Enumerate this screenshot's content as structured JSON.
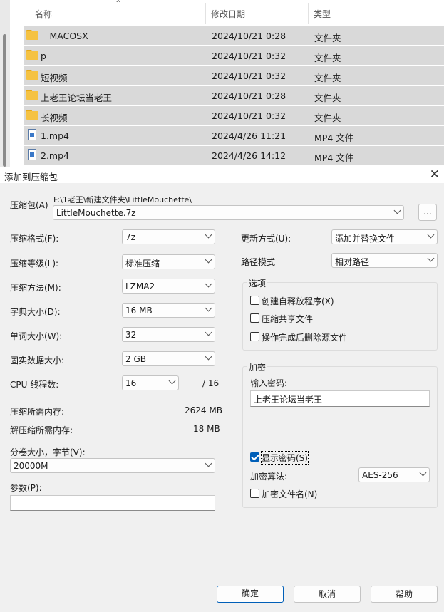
{
  "explorer": {
    "headers": {
      "name": "名称",
      "modified": "修改日期",
      "type": "类型"
    },
    "rows": [
      {
        "name": "__MACOSX",
        "date": "2024/10/21 0:28",
        "type": "文件夹",
        "icon": "folder-icon"
      },
      {
        "name": "p",
        "date": "2024/10/21 0:32",
        "type": "文件夹",
        "icon": "folder-icon"
      },
      {
        "name": "短视频",
        "date": "2024/10/21 0:32",
        "type": "文件夹",
        "icon": "folder-icon"
      },
      {
        "name": "上老王论坛当老王",
        "date": "2024/10/21 0:28",
        "type": "文件夹",
        "icon": "folder-icon"
      },
      {
        "name": "长视频",
        "date": "2024/10/21 0:32",
        "type": "文件夹",
        "icon": "folder-icon"
      },
      {
        "name": "1.mp4",
        "date": "2024/4/26 11:21",
        "type": "MP4 文件",
        "icon": "video-icon"
      },
      {
        "name": "2.mp4",
        "date": "2024/4/26 14:12",
        "type": "MP4 文件",
        "icon": "video-icon"
      }
    ]
  },
  "dialog": {
    "title": "添加到压缩包",
    "archive": {
      "label": "压缩包(A)",
      "path": "F:\\1老王\\新建文件夹\\LittleMouchette\\",
      "filename": "LittleMouchette.7z",
      "browse": "..."
    },
    "left": {
      "format_label": "压缩格式(F):",
      "format_value": "7z",
      "level_label": "压缩等级(L):",
      "level_value": "标准压缩",
      "method_label": "压缩方法(M):",
      "method_value": "LZMA2",
      "dict_label": "字典大小(D):",
      "dict_value": "16 MB",
      "word_label": "单词大小(W):",
      "word_value": "32",
      "solid_label": "固实数据大小:",
      "solid_value": "2 GB",
      "cpu_label": "CPU 线程数:",
      "cpu_value": "16",
      "cpu_total": "/ 16",
      "mem_comp_label": "压缩所需内存:",
      "mem_comp_value": "2624 MB",
      "mem_decomp_label": "解压缩所需内存:",
      "mem_decomp_value": "18 MB",
      "volume_label": "分卷大小，字节(V):",
      "volume_value": "20000M",
      "params_label": "参数(P):",
      "params_value": ""
    },
    "right": {
      "update_label": "更新方式(U):",
      "update_value": "添加并替换文件",
      "path_label": "路径模式",
      "path_value": "相对路径",
      "options_title": "选项",
      "opt_sfx": "创建自释放程序(X)",
      "opt_shared": "压缩共享文件",
      "opt_delete": "操作完成后删除源文件",
      "encrypt_title": "加密",
      "password_label": "输入密码:",
      "password_value": "上老王论坛当老王",
      "show_password": "显示密码(S)",
      "show_password_checked": true,
      "enc_method_label": "加密算法:",
      "enc_method_value": "AES-256",
      "encrypt_names": "加密文件名(N)",
      "encrypt_names_checked": false
    },
    "buttons": {
      "ok": "确定",
      "cancel": "取消",
      "help": "帮助"
    }
  }
}
